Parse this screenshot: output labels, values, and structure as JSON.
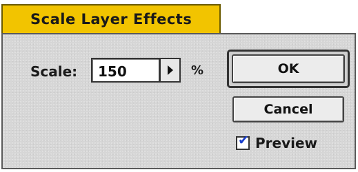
{
  "dialog": {
    "title": "Scale Layer Effects",
    "scale_label": "Scale:",
    "scale_value": "150",
    "unit": "%",
    "ok_label": "OK",
    "cancel_label": "Cancel",
    "preview_label": "Preview",
    "preview_checked": true,
    "checkmark_glyph": "✔"
  },
  "colors": {
    "title_tab": "#f2c400",
    "dialog_bg": "#d6d6d6",
    "checkmark": "#1a3fcc"
  },
  "icons": {
    "stepper": "triangle-right-icon",
    "check": "checkmark-icon"
  }
}
